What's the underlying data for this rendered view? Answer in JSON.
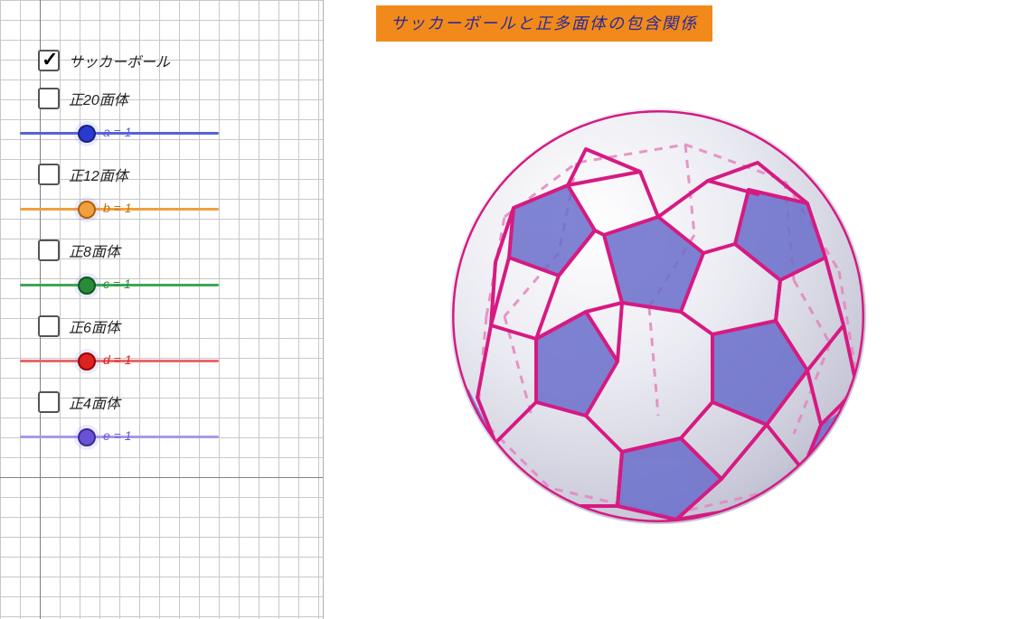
{
  "title": "サッカーボールと正多面体の包含関係",
  "checks": {
    "soccer": {
      "label": "サッカーボール",
      "checked": true
    },
    "ico": {
      "label": "正20面体",
      "checked": false
    },
    "dodec": {
      "label": "正12面体",
      "checked": false
    },
    "octa": {
      "label": "正8面体",
      "checked": false
    },
    "cube": {
      "label": "正6面体",
      "checked": false
    },
    "tetra": {
      "label": "正4面体",
      "checked": false
    }
  },
  "sliders": {
    "a": {
      "label": "a = 1",
      "value": 1,
      "color": "#5862d6"
    },
    "b": {
      "label": "b = 1",
      "value": 1,
      "color": "#f0a040"
    },
    "c": {
      "label": "c = 1",
      "value": 1,
      "color": "#3aa852"
    },
    "d": {
      "label": "d = 1",
      "value": 1,
      "color": "#e66"
    },
    "e": {
      "label": "e = 1",
      "value": 1,
      "color": "#a59be6"
    }
  },
  "colors": {
    "title_bg": "#f18a1a",
    "title_fg": "#2a2a9a",
    "edge": "#d61a82",
    "pentagon_fill": "#6a6ecb"
  }
}
